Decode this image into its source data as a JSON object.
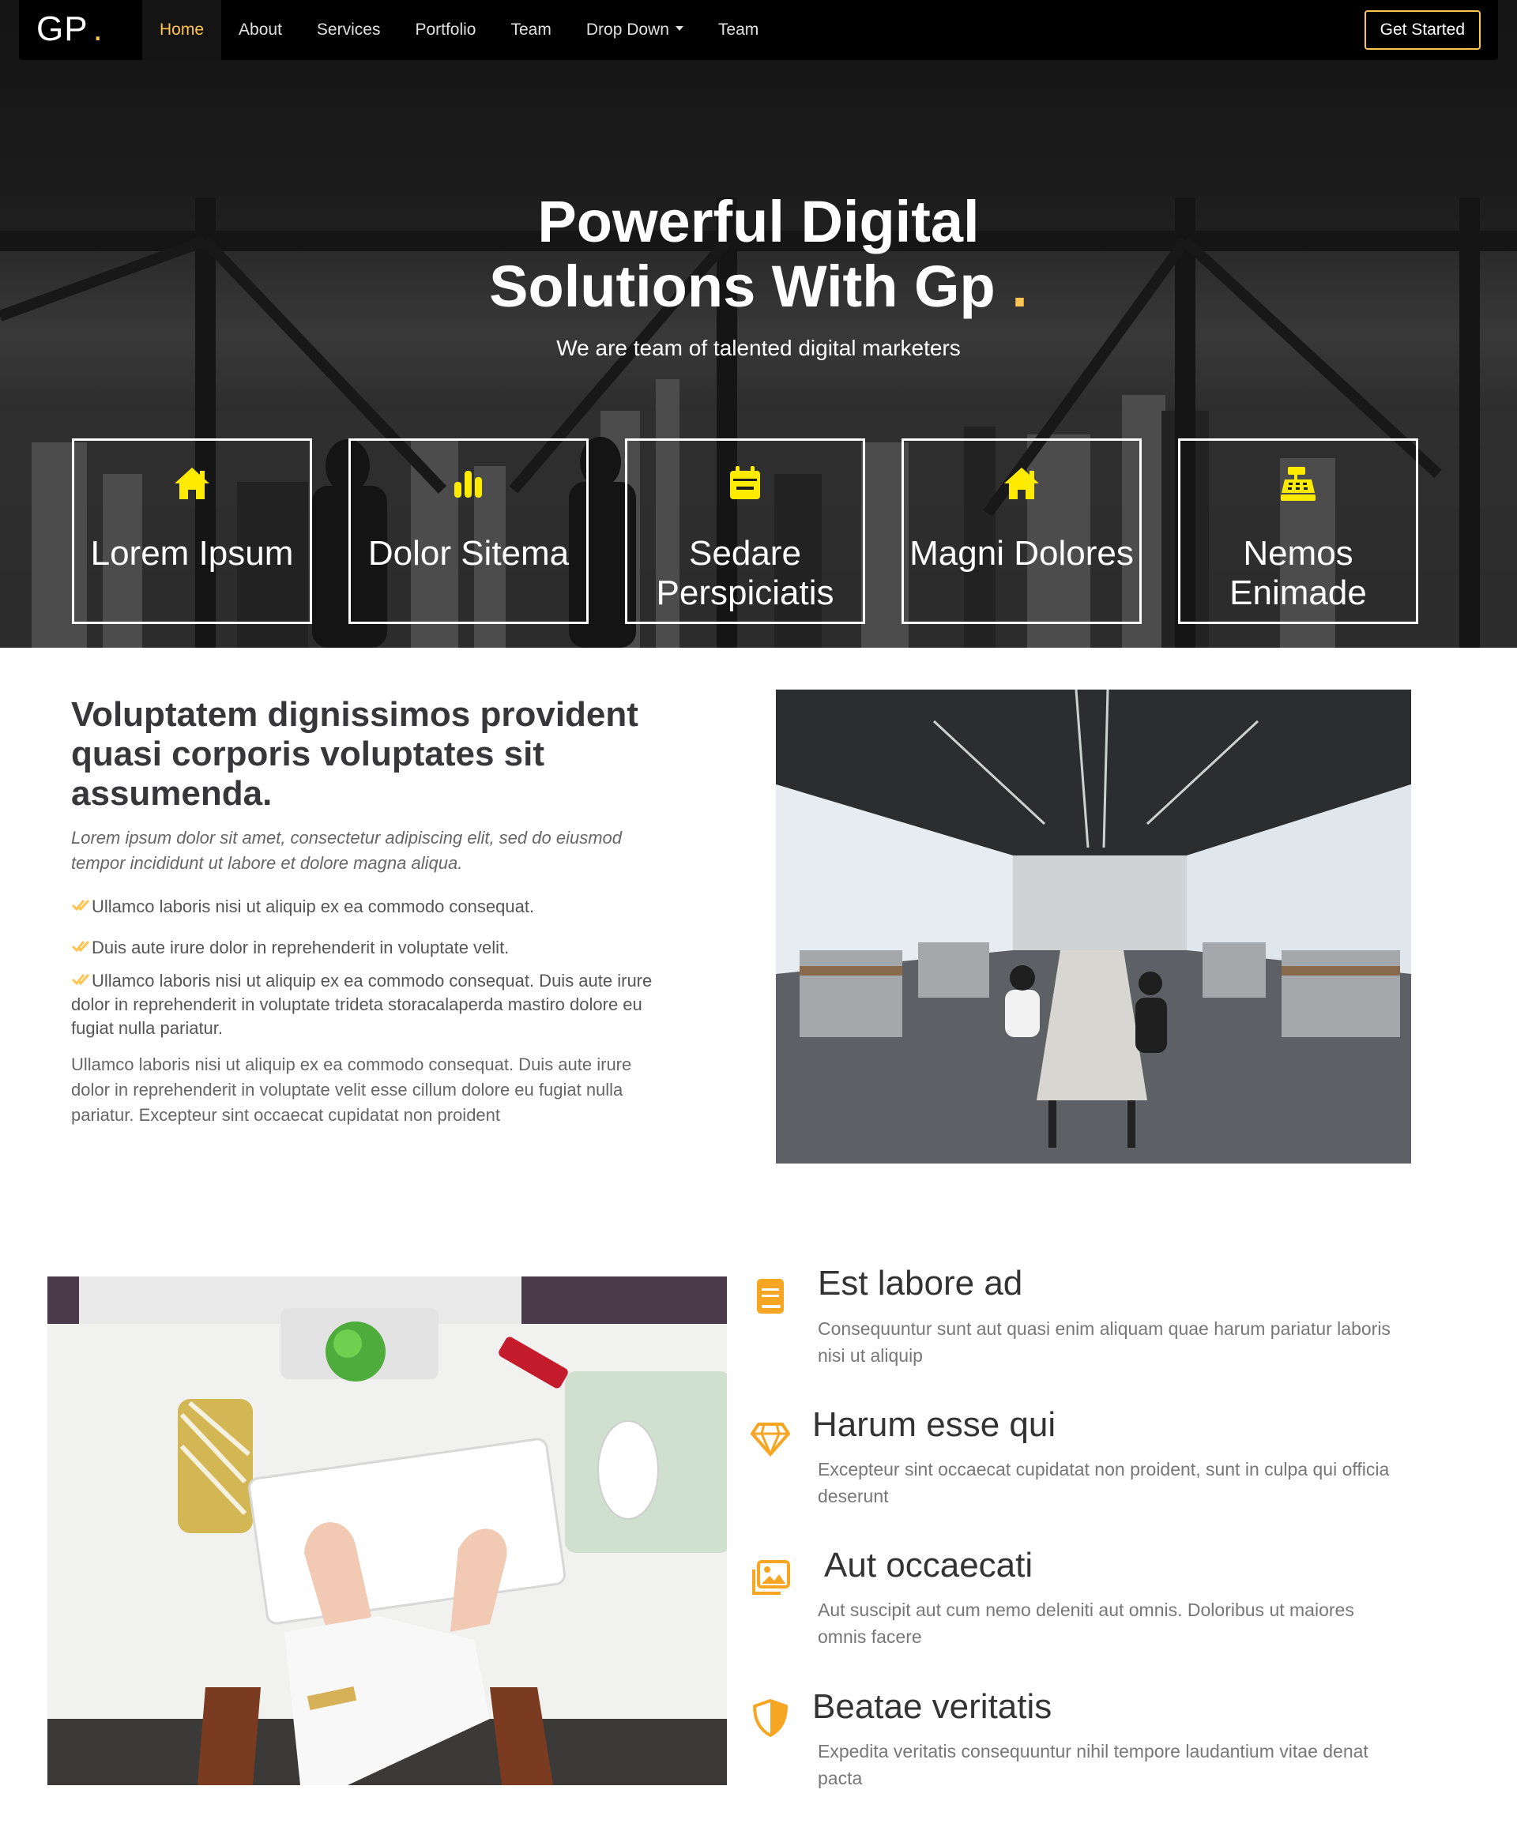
{
  "header": {
    "logo": "GP",
    "logo_dot": ".",
    "nav": [
      "Home",
      "About",
      "Services",
      "Portfolio",
      "Team",
      "Drop Down",
      "Team"
    ],
    "cta": "Get Started"
  },
  "hero": {
    "title_line1": "Powerful Digital",
    "title_line2": "Solutions With Gp",
    "title_dot": ".",
    "subtitle": "We are team of talented digital marketers",
    "boxes": [
      {
        "icon": "home-icon",
        "title": "Lorem Ipsum"
      },
      {
        "icon": "bar-chart-icon",
        "title": "Dolor Sitema"
      },
      {
        "icon": "calendar-icon",
        "title": "Sedare Perspiciatis"
      },
      {
        "icon": "home-icon",
        "title": "Magni Dolores"
      },
      {
        "icon": "cash-register-icon",
        "title": "Nemos Enimade"
      }
    ]
  },
  "about": {
    "title": "Voluptatem dignissimos provident quasi corporis voluptates sit assumenda.",
    "lead": "Lorem ipsum dolor sit amet, consectetur adipiscing elit, sed do eiusmod tempor incididunt ut labore et dolore magna aliqua.",
    "checks": [
      "Ullamco laboris nisi ut aliquip ex ea commodo consequat.",
      "Duis aute irure dolor in reprehenderit in voluptate velit.",
      "Ullamco laboris nisi ut aliquip ex ea commodo consequat. Duis aute irure dolor in reprehenderit in voluptate trideta storacalaperda mastiro dolore eu fugiat nulla pariatur."
    ],
    "paragraph": "Ullamco laboris nisi ut aliquip ex ea commodo consequat. Duis aute irure dolor in reprehenderit in voluptate velit esse cillum dolore eu fugiat nulla pariatur. Excepteur sint occaecat cupidatat non proident"
  },
  "features": [
    {
      "icon": "book-icon",
      "title": "Est labore ad",
      "desc": "Consequuntur sunt aut quasi enim aliquam quae harum pariatur laboris nisi ut aliquip"
    },
    {
      "icon": "diamond-icon",
      "title": "Harum esse qui",
      "desc": "Excepteur sint occaecat cupidatat non proident, sunt in culpa qui officia deserunt"
    },
    {
      "icon": "images-icon",
      "title": "Aut occaecati",
      "desc": "Aut suscipit aut cum nemo deleniti aut omnis. Doloribus ut maiores omnis facere"
    },
    {
      "icon": "shield-icon",
      "title": "Beatae veritatis",
      "desc": "Expedita veritatis consequuntur nihil tempore laudantium vitae denat pacta"
    }
  ],
  "colors": {
    "accent": "#ffc451",
    "hero_icon": "#ffeb00",
    "feature_icon": "#f6a623"
  }
}
